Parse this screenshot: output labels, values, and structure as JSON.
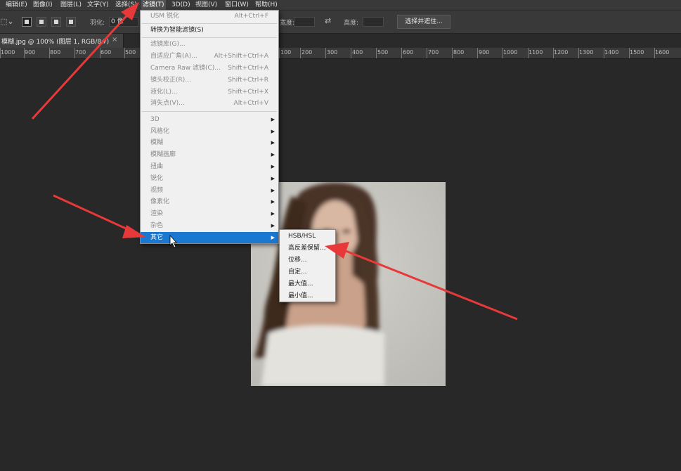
{
  "menubar": {
    "items": [
      "编辑(E)",
      "图像(I)",
      "图层(L)",
      "文字(Y)",
      "选择(S)",
      "滤镜(T)",
      "3D(D)",
      "视图(V)",
      "窗口(W)",
      "帮助(H)"
    ]
  },
  "options": {
    "feather_label": "羽化:",
    "feather_value": "0 像",
    "height_label": "高度:",
    "width_label": "宽度:",
    "select_mask_button": "选择并遮住..."
  },
  "document_tab": {
    "title": "模糊.jpg @ 100% (图层 1, RGB/8#)",
    "close": "×"
  },
  "ruler": {
    "ticks": [
      "1000",
      "900",
      "800",
      "700",
      "600",
      "500",
      "100",
      "200",
      "300",
      "400",
      "500",
      "600",
      "700",
      "800",
      "900",
      "1000",
      "1100",
      "1200",
      "1300",
      "1400",
      "1500",
      "1600"
    ]
  },
  "filter_menu": {
    "items": [
      {
        "label": "USM 锐化",
        "shortcut": "Alt+Ctrl+F",
        "disabled": true
      },
      {
        "label": "转换为智能滤镜(S)",
        "shortcut": ""
      },
      {
        "label": "滤镜库(G)...",
        "shortcut": "",
        "disabled": true
      },
      {
        "label": "自适应广角(A)...",
        "shortcut": "Alt+Shift+Ctrl+A",
        "disabled": true
      },
      {
        "label": "Camera Raw 滤镜(C)...",
        "shortcut": "Shift+Ctrl+A",
        "disabled": true
      },
      {
        "label": "镜头校正(R)...",
        "shortcut": "Shift+Ctrl+R",
        "disabled": true
      },
      {
        "label": "液化(L)...",
        "shortcut": "Shift+Ctrl+X",
        "disabled": true
      },
      {
        "label": "消失点(V)...",
        "shortcut": "Alt+Ctrl+V",
        "disabled": true
      },
      {
        "label": "3D",
        "submenu": true,
        "disabled": true
      },
      {
        "label": "风格化",
        "submenu": true,
        "disabled": true
      },
      {
        "label": "模糊",
        "submenu": true,
        "disabled": true
      },
      {
        "label": "模糊画廊",
        "submenu": true,
        "disabled": true
      },
      {
        "label": "扭曲",
        "submenu": true,
        "disabled": true
      },
      {
        "label": "锐化",
        "submenu": true,
        "disabled": true
      },
      {
        "label": "视频",
        "submenu": true,
        "disabled": true
      },
      {
        "label": "像素化",
        "submenu": true,
        "disabled": true
      },
      {
        "label": "渲染",
        "submenu": true,
        "disabled": true
      },
      {
        "label": "杂色",
        "submenu": true,
        "disabled": true
      },
      {
        "label": "其它",
        "submenu": true,
        "highlighted": true
      }
    ]
  },
  "other_submenu": {
    "items": [
      "HSB/HSL",
      "高反差保留...",
      "位移...",
      "自定...",
      "最大值...",
      "最小值..."
    ]
  },
  "colors": {
    "highlight": "#1b78d0",
    "annotation_arrow": "#e8393a"
  }
}
